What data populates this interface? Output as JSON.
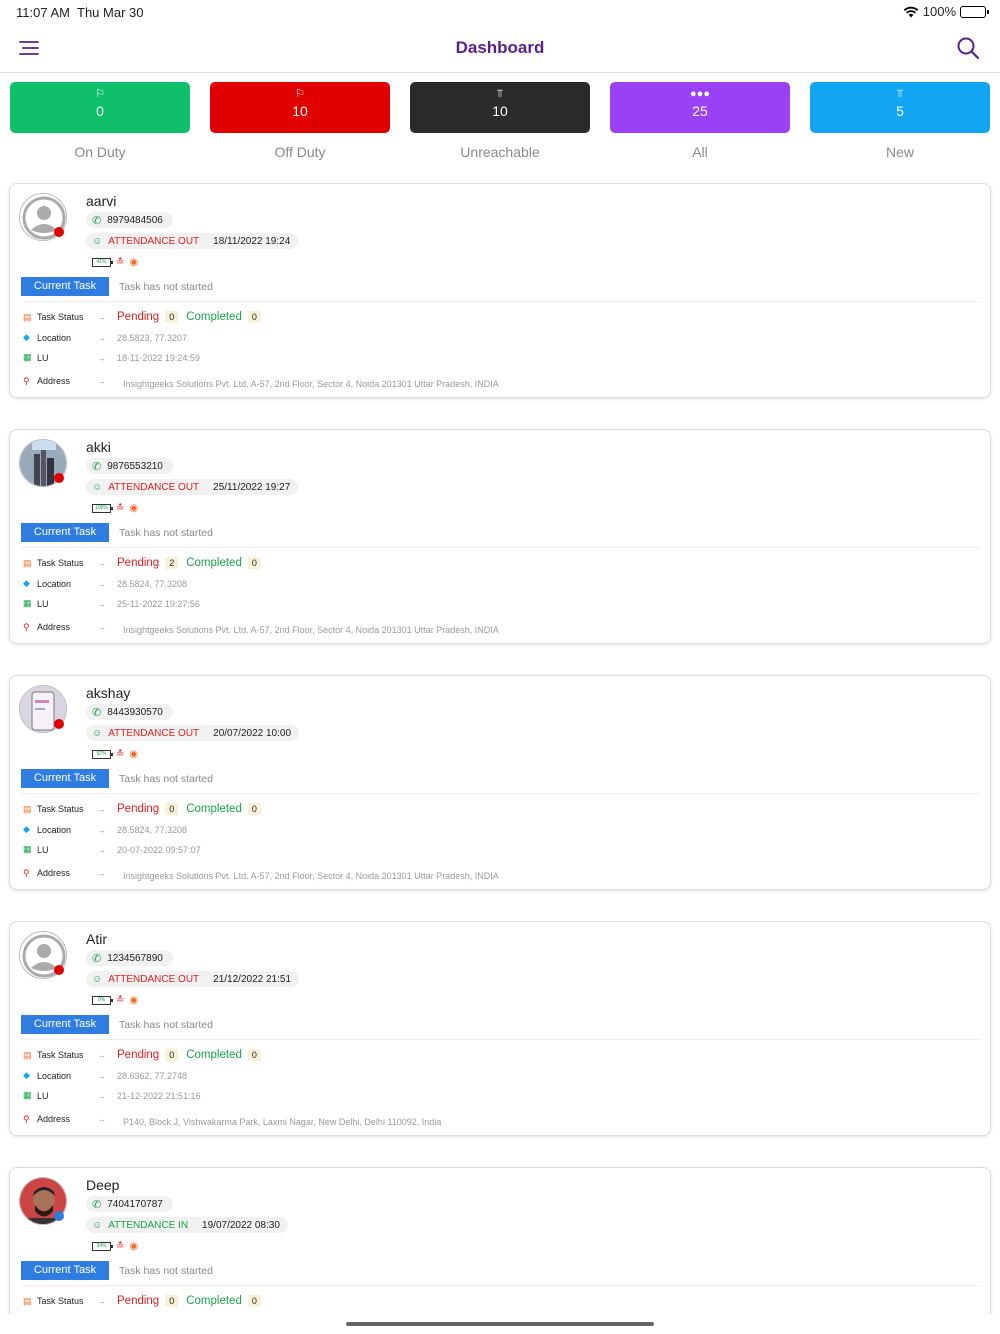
{
  "status_bar": {
    "time": "11:07 AM",
    "date": "Thu Mar 30",
    "battery": "100%"
  },
  "header": {
    "title": "Dashboard",
    "menu_icon": "menu-icon",
    "search_icon": "search-icon"
  },
  "stats": [
    {
      "label": "On Duty",
      "count": "0",
      "color": "#0fbf69",
      "icon": "bike-icon"
    },
    {
      "label": "Off Duty",
      "count": "10",
      "color": "#e00000",
      "icon": "bike-icon"
    },
    {
      "label": "Unreachable",
      "count": "10",
      "color": "#2b2b2b",
      "icon": "no-signal-icon"
    },
    {
      "label": "All",
      "count": "25",
      "color": "#9a40f5",
      "icon": "group-icon"
    },
    {
      "label": "New",
      "count": "5",
      "color": "#12a5f2",
      "icon": "signal-icon"
    }
  ],
  "labels": {
    "current_task": "Current Task",
    "task_status": "Task Status",
    "location": "Location",
    "lu": "LU",
    "address": "Address",
    "pending": "Pending",
    "completed": "Completed"
  },
  "employees": [
    {
      "name": "aarvi",
      "phone": "8979484506",
      "attendance_status": "ATTENDANCE OUT",
      "attendance_time": "18/11/2022 19:24",
      "battery": "41%",
      "task_text": "Task has not started",
      "pending": "0",
      "completed": "0",
      "location": "28.5823, 77.3207",
      "lu": "18-11-2022 19:24:59",
      "address": "Insightgeeks Solutions Pvt. Ltd. A-57, 2nd Floor, Sector 4, Noida 201301 Uttar Pradesh, INDIA",
      "online": false,
      "avatar": "placeholder"
    },
    {
      "name": "akki",
      "phone": "9876553210",
      "attendance_status": "ATTENDANCE OUT",
      "attendance_time": "25/11/2022 19:27",
      "battery": "100%",
      "task_text": "Task has not started",
      "pending": "2",
      "completed": "0",
      "location": "28.5824, 77.3208",
      "lu": "25-11-2022 19:27:56",
      "address": "Insightgeeks Solutions Pvt. Ltd. A-57, 2nd Floor, Sector 4, Noida 201301 Uttar Pradesh, INDIA",
      "online": false,
      "avatar": "city"
    },
    {
      "name": "akshay",
      "phone": "8443930570",
      "attendance_status": "ATTENDANCE OUT",
      "attendance_time": "20/07/2022 10:00",
      "battery": "92%",
      "task_text": "Task has not started",
      "pending": "0",
      "completed": "0",
      "location": "28.5824, 77.3208",
      "lu": "20-07-2022 09:57:07",
      "address": "Insightgeeks Solutions Pvt. Ltd. A-57, 2nd Floor, Sector 4, Noida 201301 Uttar Pradesh, INDIA",
      "online": false,
      "avatar": "phone"
    },
    {
      "name": "Atir",
      "phone": "1234567890",
      "attendance_status": "ATTENDANCE OUT",
      "attendance_time": "21/12/2022 21:51",
      "battery": "0%",
      "task_text": "Task has not started",
      "pending": "0",
      "completed": "0",
      "location": "28.6362, 77.2748",
      "lu": "21-12-2022 21:51:16",
      "address": "P140, Block J, Vishwakarma Park, Laxmi Nagar, New Delhi, Delhi 110092, India",
      "online": false,
      "avatar": "placeholder"
    },
    {
      "name": "Deep",
      "phone": "7404170787",
      "attendance_status": "ATTENDANCE IN",
      "attendance_time": "19/07/2022 08:30",
      "battery": "34%",
      "task_text": "Task has not started",
      "pending": "0",
      "completed": "0",
      "location": "",
      "lu": "",
      "address": "",
      "online": true,
      "avatar": "person"
    }
  ]
}
